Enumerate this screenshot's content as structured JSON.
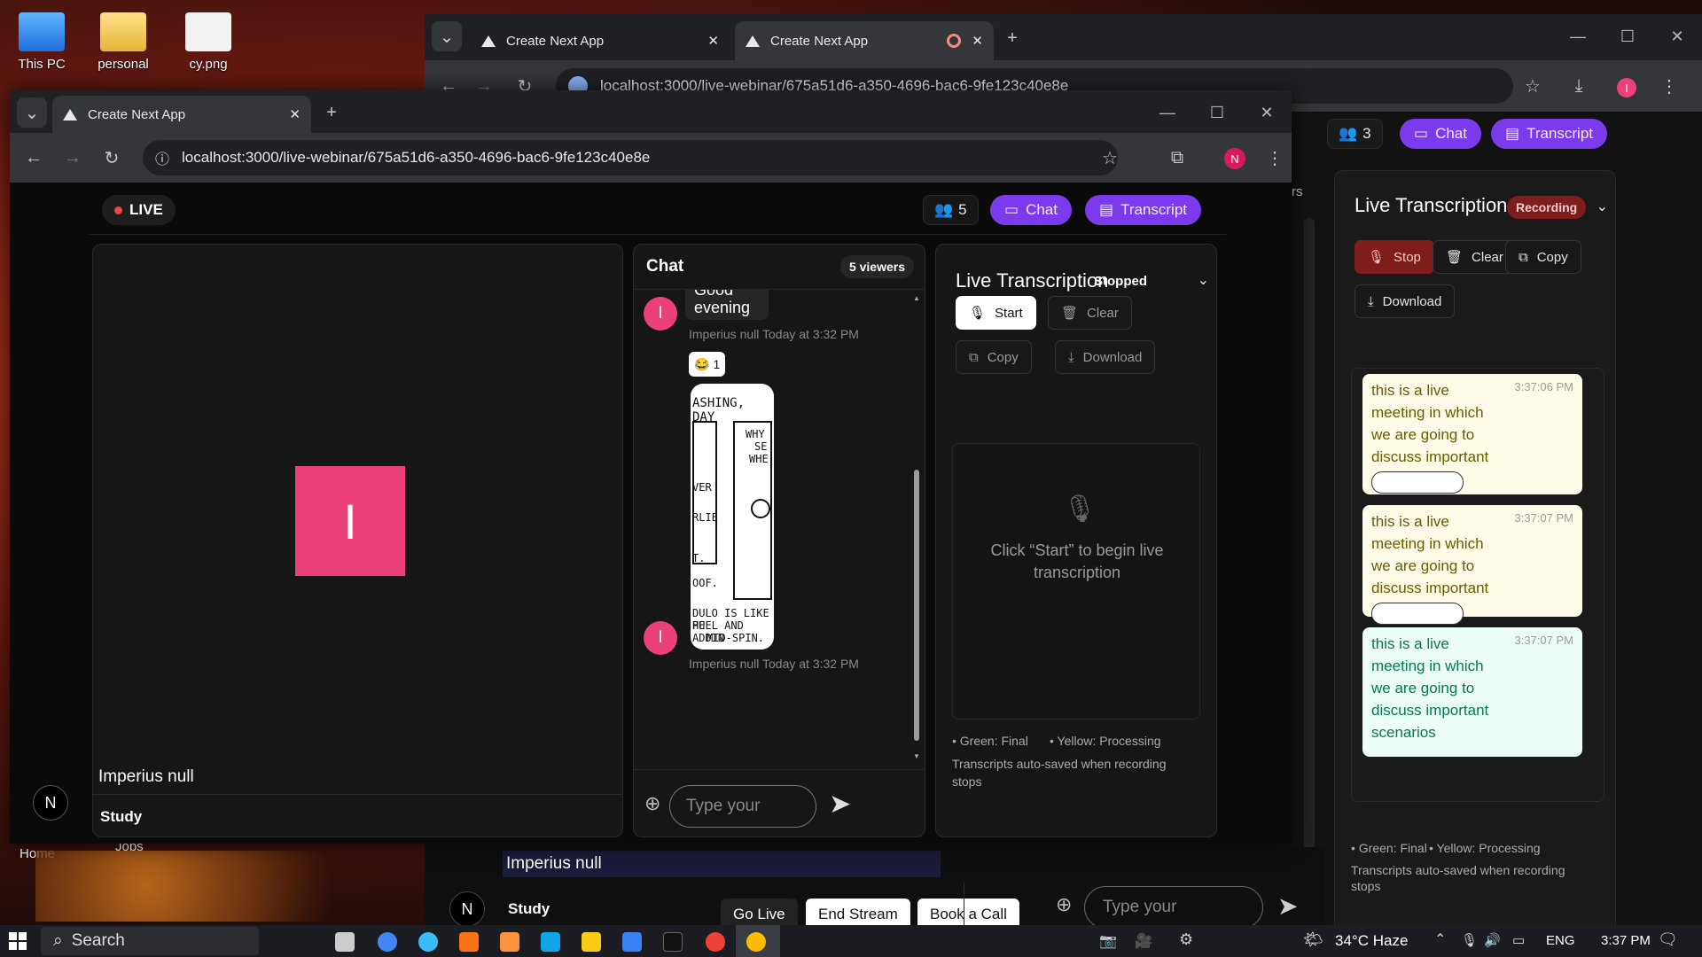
{
  "desktop": {
    "icons": [
      {
        "label": "This PC"
      },
      {
        "label": "personal"
      },
      {
        "label": "cy.png"
      }
    ]
  },
  "back_window": {
    "tabs": [
      {
        "title": "Create Next App"
      },
      {
        "title": "Create Next App"
      }
    ],
    "url": "localhost:3000/live-webinar/675a51d6-a350-4696-bac6-9fe123c40e8e",
    "profile_initial": "I",
    "viewer_count": "3",
    "chat_label": "Chat",
    "transcript_label": "Transcript",
    "side_frag": "rs",
    "transcription": {
      "title": "Live Transcription",
      "status": "Recording",
      "stop_label": "Stop",
      "clear_label": "Clear",
      "copy_label": "Copy",
      "download_label": "Download",
      "entries": [
        {
          "text": "this is a live meeting in which we are going to discuss important",
          "time": "3:37:06 PM",
          "state": "processing"
        },
        {
          "text": "this is a live meeting in which we are going to discuss important",
          "time": "3:37:07 PM",
          "state": "processing"
        },
        {
          "text": "this is a live meeting in which we are going to discuss important scenarios",
          "time": "3:37:07 PM",
          "state": "final"
        }
      ],
      "legend_final": "• Green: Final",
      "legend_processing": "• Yellow: Processing",
      "autosave_note": "Transcripts auto-saved when recording stops"
    },
    "chat_placeholder": "Type your",
    "host_name": "Imperius null",
    "host_role": "Study",
    "host_initial": "N",
    "go_live_label": "Go Live",
    "end_stream_label": "End Stream",
    "book_call_label": "Book a Call",
    "bottom_left_labels": [
      "Home",
      "Jobs"
    ]
  },
  "front_window": {
    "tab_title": "Create Next App",
    "url": "localhost:3000/live-webinar/675a51d6-a350-4696-bac6-9fe123c40e8e",
    "profile_initial": "N",
    "live_badge": "LIVE",
    "viewer_count": "5",
    "chat_label": "Chat",
    "transcript_label": "Transcript",
    "video": {
      "avatar_initial": "I",
      "participant_name": "Imperius null",
      "host_initial": "N",
      "host_role": "Study"
    },
    "chat": {
      "title": "Chat",
      "viewers_badge": "5 viewers",
      "messages": [
        {
          "avatar": "I",
          "text_partial": "Good",
          "text": "evening",
          "meta": "Imperius null Today at 3:32 PM",
          "reaction_emoji": "😂",
          "reaction_count": "1"
        },
        {
          "avatar": "I",
          "comic_lines": [
            "ASHING, DAY",
            "WHY",
            "SE",
            "WHE",
            "VER",
            "RLIE",
            "T.",
            "OOF.",
            "DULO IS LIKE PU",
            "HEEL AND ADDIN",
            "MID-SPIN."
          ],
          "meta": "Imperius null Today at 3:32 PM"
        }
      ],
      "input_placeholder": "Type your"
    },
    "transcription": {
      "title": "Live Transcription",
      "status": "Stopped",
      "start_label": "Start",
      "clear_label": "Clear",
      "copy_label": "Copy",
      "download_label": "Download",
      "empty_message": "Click “Start” to begin live transcription",
      "legend_final": "• Green: Final",
      "legend_processing": "• Yellow: Processing",
      "autosave_note": "Transcripts auto-saved when recording stops"
    }
  },
  "taskbar": {
    "search_label": "Search",
    "weather": "34°C  Haze",
    "language": "ENG",
    "time": "3:37 PM"
  },
  "colors": {
    "accent_purple": "#7c3aed",
    "avatar_pink": "#ec407a",
    "card_processing": "#fefce8",
    "card_final": "#ecfdf5",
    "recording_red": "#7f1d1d"
  }
}
